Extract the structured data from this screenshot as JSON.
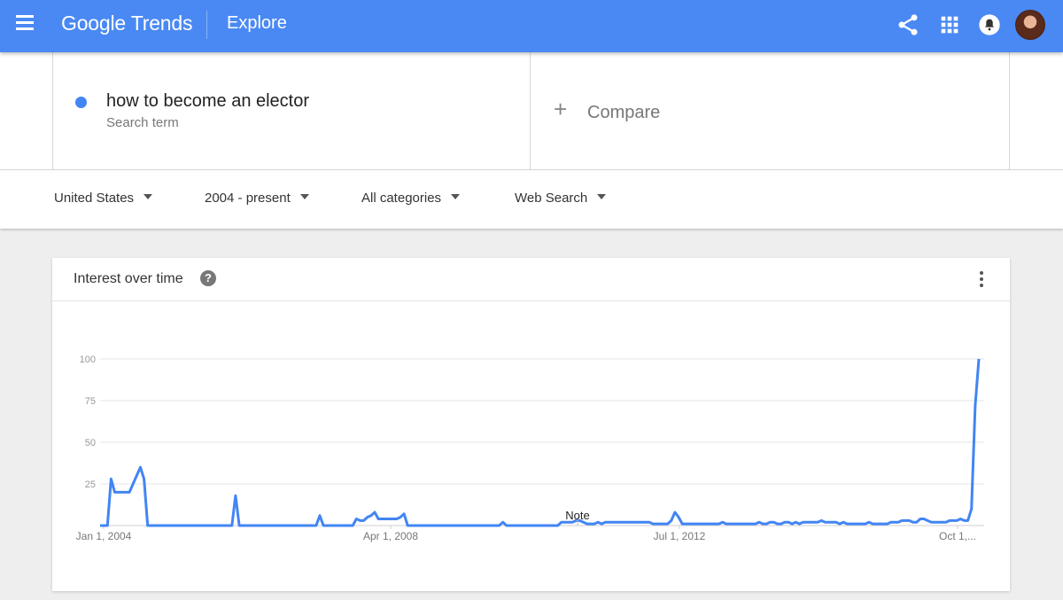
{
  "header": {
    "logo": "Google Trends",
    "page": "Explore",
    "icons": [
      "menu-icon",
      "share-icon",
      "apps-grid-icon",
      "notifications-icon",
      "avatar"
    ],
    "color": "#4a89f3"
  },
  "search": {
    "term": "how to become an elector",
    "term_type": "Search term",
    "term_color": "#4285f4",
    "compare_label": "Compare",
    "compare_symbol": "+"
  },
  "filters": {
    "region": "United States",
    "time": "2004 - present",
    "category": "All categories",
    "property": "Web Search"
  },
  "card": {
    "title": "Interest over time",
    "help_symbol": "?"
  },
  "chart_data": {
    "type": "line",
    "title": "Interest over time",
    "xlabel": "",
    "ylabel": "",
    "ylim": [
      0,
      100
    ],
    "yticks": [
      "100",
      "75",
      "50",
      "25"
    ],
    "xticks": [
      "Jan 1, 2004",
      "Apr 1, 2008",
      "Jul 1, 2012",
      "Oct 1,..."
    ],
    "annotation": "Note",
    "grid": true,
    "series": [
      {
        "name": "how to become an elector",
        "color": "#4285f4",
        "x_months": [
          0,
          1,
          2,
          3,
          4,
          5,
          6,
          7,
          8,
          9,
          10,
          11,
          12,
          13,
          14,
          15,
          16,
          17,
          18,
          19,
          20,
          21,
          22,
          23,
          24,
          25,
          26,
          27,
          28,
          29,
          30,
          31,
          32,
          33,
          34,
          35,
          36,
          37,
          38,
          39,
          40,
          41,
          42,
          43,
          44,
          45,
          46,
          47,
          48,
          49,
          50,
          51,
          52,
          53,
          54,
          55,
          56,
          57,
          58,
          59,
          60,
          61,
          62,
          63,
          64,
          65,
          66,
          67,
          68,
          69,
          70,
          71,
          72,
          73,
          74,
          75,
          76,
          77,
          78,
          79,
          80,
          81,
          82,
          83,
          84,
          85,
          86,
          87,
          88,
          89,
          90,
          91,
          92,
          93,
          94,
          95,
          96,
          97,
          98,
          99,
          100,
          101,
          102,
          103,
          104,
          105,
          106,
          107,
          108,
          109,
          110,
          111,
          112,
          113,
          114,
          115,
          116,
          117,
          118,
          119,
          120,
          121,
          122,
          123,
          124,
          125,
          126,
          127,
          128,
          129,
          130,
          131,
          132,
          133,
          134,
          135,
          136,
          137,
          138,
          139,
          140,
          141,
          142,
          143,
          144,
          145,
          146,
          147,
          148,
          149,
          150,
          151,
          152,
          153,
          154,
          155,
          156,
          157,
          158,
          159,
          160,
          161,
          162,
          163,
          164,
          165,
          166,
          167,
          168,
          169,
          170,
          171,
          172,
          173,
          174,
          175,
          176,
          177,
          178,
          179,
          180,
          181,
          182,
          183,
          184,
          185,
          186,
          187,
          188,
          189,
          190,
          191,
          192,
          193,
          194,
          195,
          196,
          197,
          198,
          199,
          200,
          201,
          202,
          203,
          204,
          205,
          206,
          207,
          208,
          209,
          210,
          211,
          212,
          213,
          214,
          215,
          216,
          217,
          218,
          219,
          220,
          221,
          222,
          223,
          224,
          225,
          226,
          227,
          228,
          229,
          230,
          231,
          232,
          233,
          234,
          235,
          236,
          237,
          238,
          239,
          240,
          241,
          242,
          243,
          244,
          245,
          246,
          247,
          248,
          249,
          250,
          251,
          252,
          253,
          254,
          255,
          256
        ],
        "values": [
          0,
          0,
          0,
          28,
          20,
          20,
          20,
          20,
          20,
          25,
          30,
          35,
          28,
          0,
          0,
          0,
          0,
          0,
          0,
          0,
          0,
          0,
          0,
          0,
          0,
          0,
          0,
          0,
          0,
          0,
          0,
          0,
          0,
          0,
          0,
          0,
          0,
          18,
          0,
          0,
          0,
          0,
          0,
          0,
          0,
          0,
          0,
          0,
          0,
          0,
          0,
          0,
          0,
          0,
          0,
          0,
          0,
          0,
          0,
          0,
          6,
          0,
          0,
          0,
          0,
          0,
          0,
          0,
          0,
          0,
          4,
          3,
          3,
          5,
          6,
          8,
          4,
          4,
          4,
          4,
          4,
          4,
          5,
          7,
          0,
          0,
          0,
          0,
          0,
          0,
          0,
          0,
          0,
          0,
          0,
          0,
          0,
          0,
          0,
          0,
          0,
          0,
          0,
          0,
          0,
          0,
          0,
          0,
          0,
          0,
          2,
          0,
          0,
          0,
          0,
          0,
          0,
          0,
          0,
          0,
          0,
          0,
          0,
          0,
          0,
          0,
          2,
          2,
          2,
          2,
          3,
          3,
          2,
          1,
          1,
          1,
          2,
          1,
          2,
          2,
          2,
          2,
          2,
          2,
          2,
          2,
          2,
          2,
          2,
          2,
          2,
          1,
          1,
          1,
          1,
          1,
          3,
          8,
          5,
          1,
          1,
          1,
          1,
          1,
          1,
          1,
          1,
          1,
          1,
          1,
          2,
          1,
          1,
          1,
          1,
          1,
          1,
          1,
          1,
          1,
          2,
          1,
          1,
          2,
          2,
          1,
          1,
          2,
          2,
          1,
          2,
          1,
          2,
          2,
          2,
          2,
          2,
          3,
          2,
          2,
          2,
          2,
          1,
          2,
          1,
          1,
          1,
          1,
          1,
          1,
          2,
          1,
          1,
          1,
          1,
          1,
          2,
          2,
          2,
          3,
          3,
          3,
          2,
          2,
          4,
          4,
          3,
          2,
          2,
          2,
          2,
          2,
          3,
          3,
          3,
          4,
          3,
          3,
          10,
          72,
          100
        ]
      }
    ]
  }
}
